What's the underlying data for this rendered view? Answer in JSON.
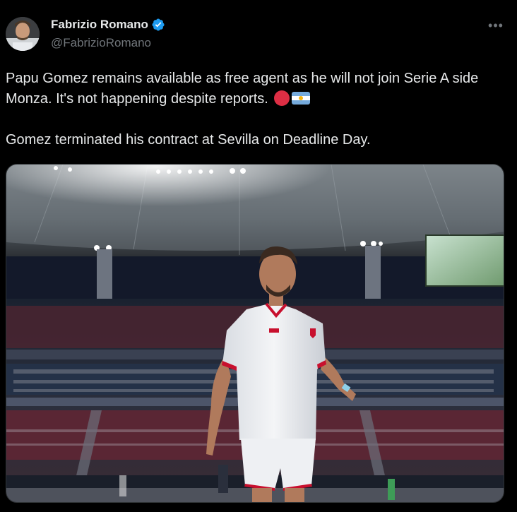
{
  "author": {
    "name": "Fabrizio Romano",
    "handle": "@FabrizioRomano",
    "verified": true,
    "avatar_icon": "profile-photo"
  },
  "menu": {
    "more_icon": "more-horizontal-icon"
  },
  "tweet": {
    "paragraph_1": "Papu Gomez remains available as free agent as he will not join Serie A side Monza. It's not happening despite reports.",
    "paragraph_1_emojis": [
      "red-circle",
      "argentina-flag"
    ],
    "paragraph_2": "Gomez terminated his contract at Sevilla on Deadline Day."
  },
  "media": {
    "type": "photo"
  },
  "colors": {
    "background": "#000000",
    "text_primary": "#e7e9ea",
    "text_secondary": "#71767b",
    "verified_blue": "#1d9bf0",
    "red_circle": "#dd2e44"
  }
}
